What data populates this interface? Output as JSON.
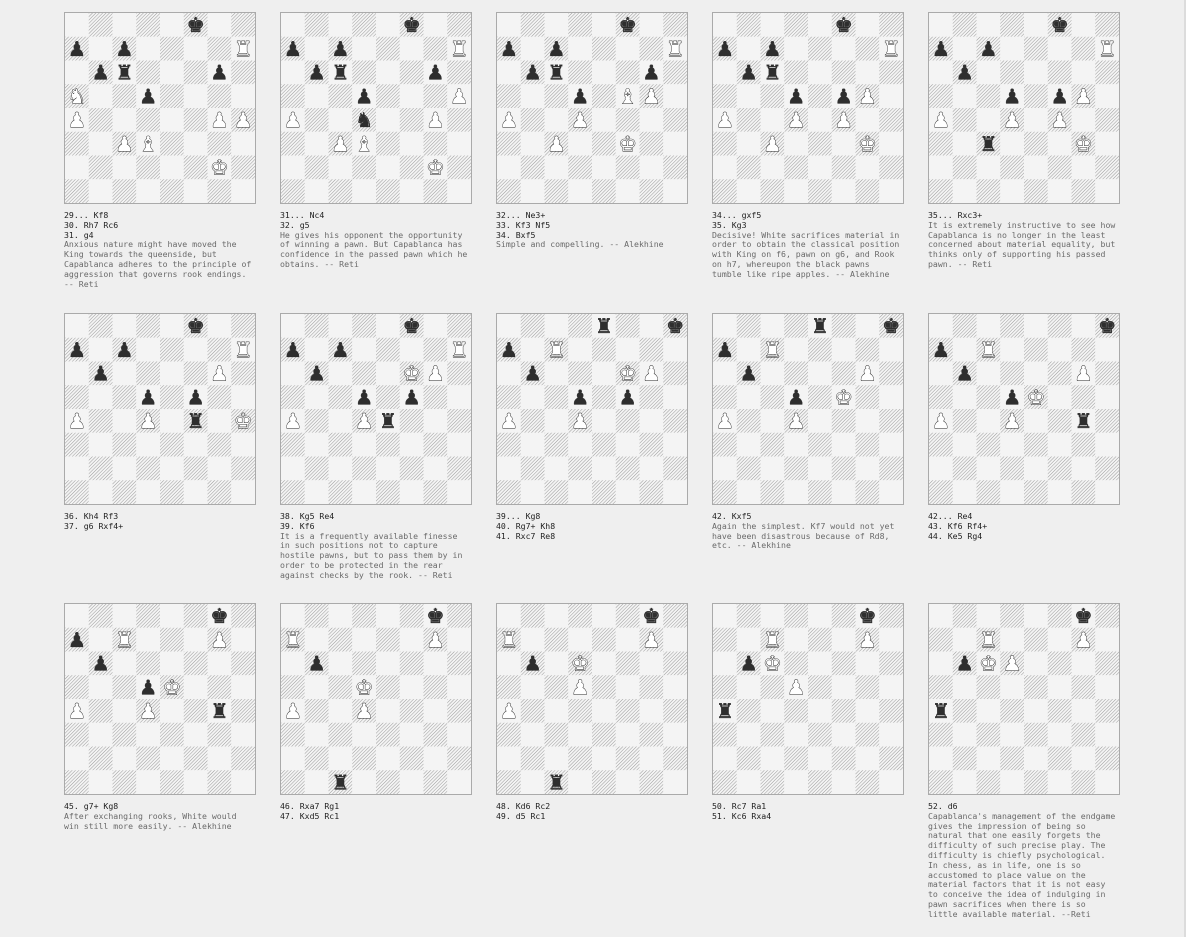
{
  "diagrams": [
    {
      "fen": "5k2/p1p4R/1pr3p1/N2p4/P5PP/2PB4/6K1/8",
      "moves": [
        "29... Kf8",
        "30. Rh7 Rc6",
        "31. g4"
      ],
      "comment": "Anxious nature might have moved the King towards the queenside, but Capablanca adheres to the principle of aggression that governs rook endings. -- Reti"
    },
    {
      "fen": "5k2/p1p4R/1pr3p1/3p3P/P2n2P1/2PB4/6K1/8",
      "moves": [
        "31... Nc4",
        "32. g5"
      ],
      "comment": "He gives his opponent the opportunity of winning a pawn. But Capablanca has confidence in the passed pawn which he obtains. -- Reti"
    },
    {
      "fen": "5k2/p1p4R/1pr3p1/3p1BP1/P2P4/2P2K2/8/8",
      "moves": [
        "32... Ne3+",
        "33. Kf3 Nf5",
        "34. Bxf5"
      ],
      "comment": "Simple and compelling. -- Alekhine"
    },
    {
      "fen": "5k2/p1p4R/1pr5/3p1pP1/P2P1P2/2P3K1/8/8",
      "moves": [
        "34... gxf5",
        "35. Kg3"
      ],
      "comment": "Decisive! White sacrifices material in order to obtain the classical position with King on f6, pawn on g6, and Rook on h7, whereupon the black pawns tumble like ripe apples. -- Alekhine"
    },
    {
      "fen": "5k2/p1p4R/1p6/3p1pP1/P2P1P2/2r3K1/8/8",
      "moves": [
        "35... Rxc3+"
      ],
      "comment": "It is extremely instructive to see how Capablanca is no longer in the least concerned about material equality, but thinks only of supporting his passed pawn. -- Reti"
    },
    {
      "fen": "5k2/p1p4R/1p4P1/3p1p2/P2P1r1K/8/8/8",
      "moves": [
        "36. Kh4 Rf3",
        "37. g6 Rxf4+"
      ],
      "comment": ""
    },
    {
      "fen": "5k2/p1p4R/1p3KP1/3p1p2/P2Pr3/8/8/8",
      "moves": [
        "38. Kg5 Re4",
        "39. Kf6"
      ],
      "comment": "It is a frequently available finesse in such positions not to capture hostile pawns, but to pass them by in order to be protected in the rear against checks by the rook. -- Reti"
    },
    {
      "fen": "4r2k/p1R5/1p3KP1/3p1p2/P2P4/8/8/8",
      "moves": [
        "39... Kg8",
        "40. Rg7+ Kh8",
        "41. Rxc7 Re8"
      ],
      "comment": ""
    },
    {
      "fen": "4r2k/p1R5/1p4P1/3p1K2/P2P4/8/8/8",
      "moves": [
        "42. Kxf5"
      ],
      "comment": "Again the simplest. Kf7 would not yet have been disastrous because of Rd8, etc. -- Alekhine"
    },
    {
      "fen": "7k/p1R5/1p4P1/3pK3/P2P2r1/8/8/8",
      "moves": [
        "42... Re4",
        "43. Kf6 Rf4+",
        "44. Ke5 Rg4"
      ],
      "comment": ""
    },
    {
      "fen": "6k1/p1R3P1/1p6/3pK3/P2P2r1/8/8/8",
      "moves": [
        "45. g7+ Kg8"
      ],
      "comment": "After exchanging rooks, White would win still more easily. -- Alekhine"
    },
    {
      "fen": "6k1/R5P1/1p6/3K4/P2P4/8/8/2r5",
      "moves": [
        "46. Rxa7 Rg1",
        "47. Kxd5 Rc1"
      ],
      "comment": ""
    },
    {
      "fen": "6k1/R5P1/1p1K4/3P4/P7/8/8/2r5",
      "moves": [
        "48. Kd6 Rc2",
        "49. d5 Rc1"
      ],
      "comment": ""
    },
    {
      "fen": "6k1/2R3P1/1pK5/3P4/r7/8/8/8",
      "moves": [
        "50. Rc7 Ra1",
        "51. Kc6 Rxa4"
      ],
      "comment": ""
    },
    {
      "fen": "6k1/2R3P1/1pKP4/8/r7/8/8/8",
      "moves": [
        "52. d6"
      ],
      "comment": "Capablanca's management of the endgame gives the impression of being so natural that one easily forgets the difficulty of such precise play. The difficulty is chiefly psychological. In chess, as in life, one is so accustomed to place value on the material factors that it is not easy to conceive the idea of indulging in pawn sacrifices when there is so little available material. --Reti"
    }
  ],
  "colors": {
    "light": "#f4f4f4",
    "dark_hatch": "#9a9a9a",
    "white_piece": "#ffffff",
    "black_piece": "#2e2e2e",
    "border": "#aaaaaa"
  },
  "glyphs": {
    "k": "♚",
    "q": "♛",
    "r": "♜",
    "b": "♝",
    "n": "♞",
    "p": "♟"
  }
}
